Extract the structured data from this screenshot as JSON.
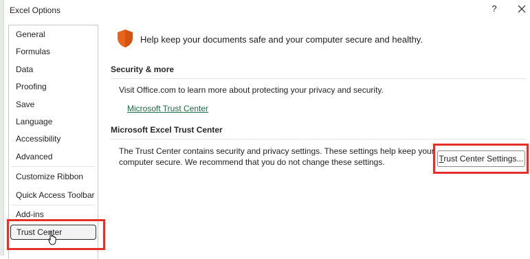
{
  "window": {
    "title": "Excel Options",
    "help_label": "?",
    "close_icon": "close-icon"
  },
  "nav": {
    "items": [
      {
        "label": "General"
      },
      {
        "label": "Formulas"
      },
      {
        "label": "Data"
      },
      {
        "label": "Proofing"
      },
      {
        "label": "Save"
      },
      {
        "label": "Language"
      },
      {
        "label": "Accessibility"
      },
      {
        "label": "Advanced"
      },
      {
        "label": "Customize Ribbon"
      },
      {
        "label": "Quick Access Toolbar"
      },
      {
        "label": "Add-ins"
      },
      {
        "label": "Trust Center",
        "selected": true
      }
    ]
  },
  "main": {
    "hero_icon": "shield-icon",
    "hero_text": "Help keep your documents safe and your computer secure and healthy.",
    "security_more": {
      "title": "Security & more",
      "description": "Visit Office.com to learn more about protecting your privacy and security.",
      "link": "Microsoft Trust Center"
    },
    "trust_center": {
      "title": "Microsoft Excel Trust Center",
      "description_line1": "The Trust Center contains security and privacy settings. These settings help keep your",
      "description_line2": "computer secure. We recommend that you do not change these settings.",
      "button_prefix": "",
      "button_mnemonic": "T",
      "button_rest": "rust Center Settings..."
    }
  },
  "colors": {
    "highlight": "#e5302a",
    "link": "#1a6b44",
    "shield": "#e8641b"
  }
}
